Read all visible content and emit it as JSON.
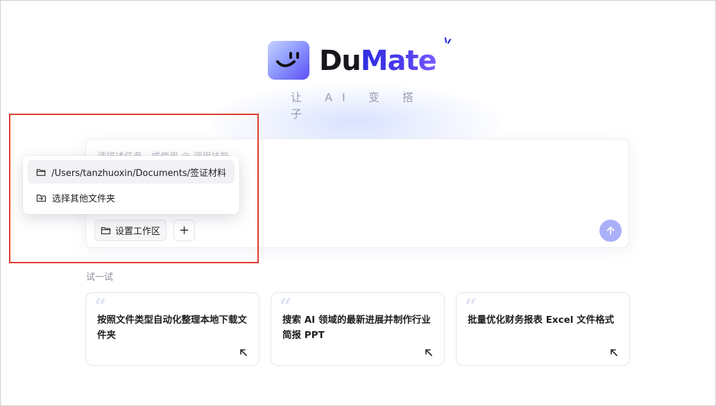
{
  "brand": {
    "name_prefix": "Du",
    "name_accent": "Mate",
    "tagline": "让 AI 变 搭 子",
    "logo_icon": "smile-face-icon"
  },
  "input": {
    "placeholder": "请描述任务，或使用 @ 调用技能",
    "workspace_button_label": "设置工作区",
    "add_button_label": "+",
    "send_icon": "arrow-up-icon",
    "colors": {
      "send": "#aab0f8"
    }
  },
  "workspace_menu": {
    "items": [
      {
        "label": "/Users/tanzhuoxin/Documents/签证材料",
        "icon": "folder-icon"
      },
      {
        "label": "选择其他文件夹",
        "icon": "folder-open-icon"
      }
    ]
  },
  "try_section": {
    "label": "试一试",
    "cards": [
      {
        "text": "按照文件类型自动化整理本地下载文件夹",
        "icon": "arrow-up-left-icon"
      },
      {
        "text": "搜索 AI 领域的最新进展并制作行业简报 PPT",
        "icon": "arrow-up-left-icon"
      },
      {
        "text": "批量优化财务报表 Excel 文件格式",
        "icon": "arrow-up-left-icon"
      }
    ]
  },
  "annotation_color": "#e03a2f"
}
